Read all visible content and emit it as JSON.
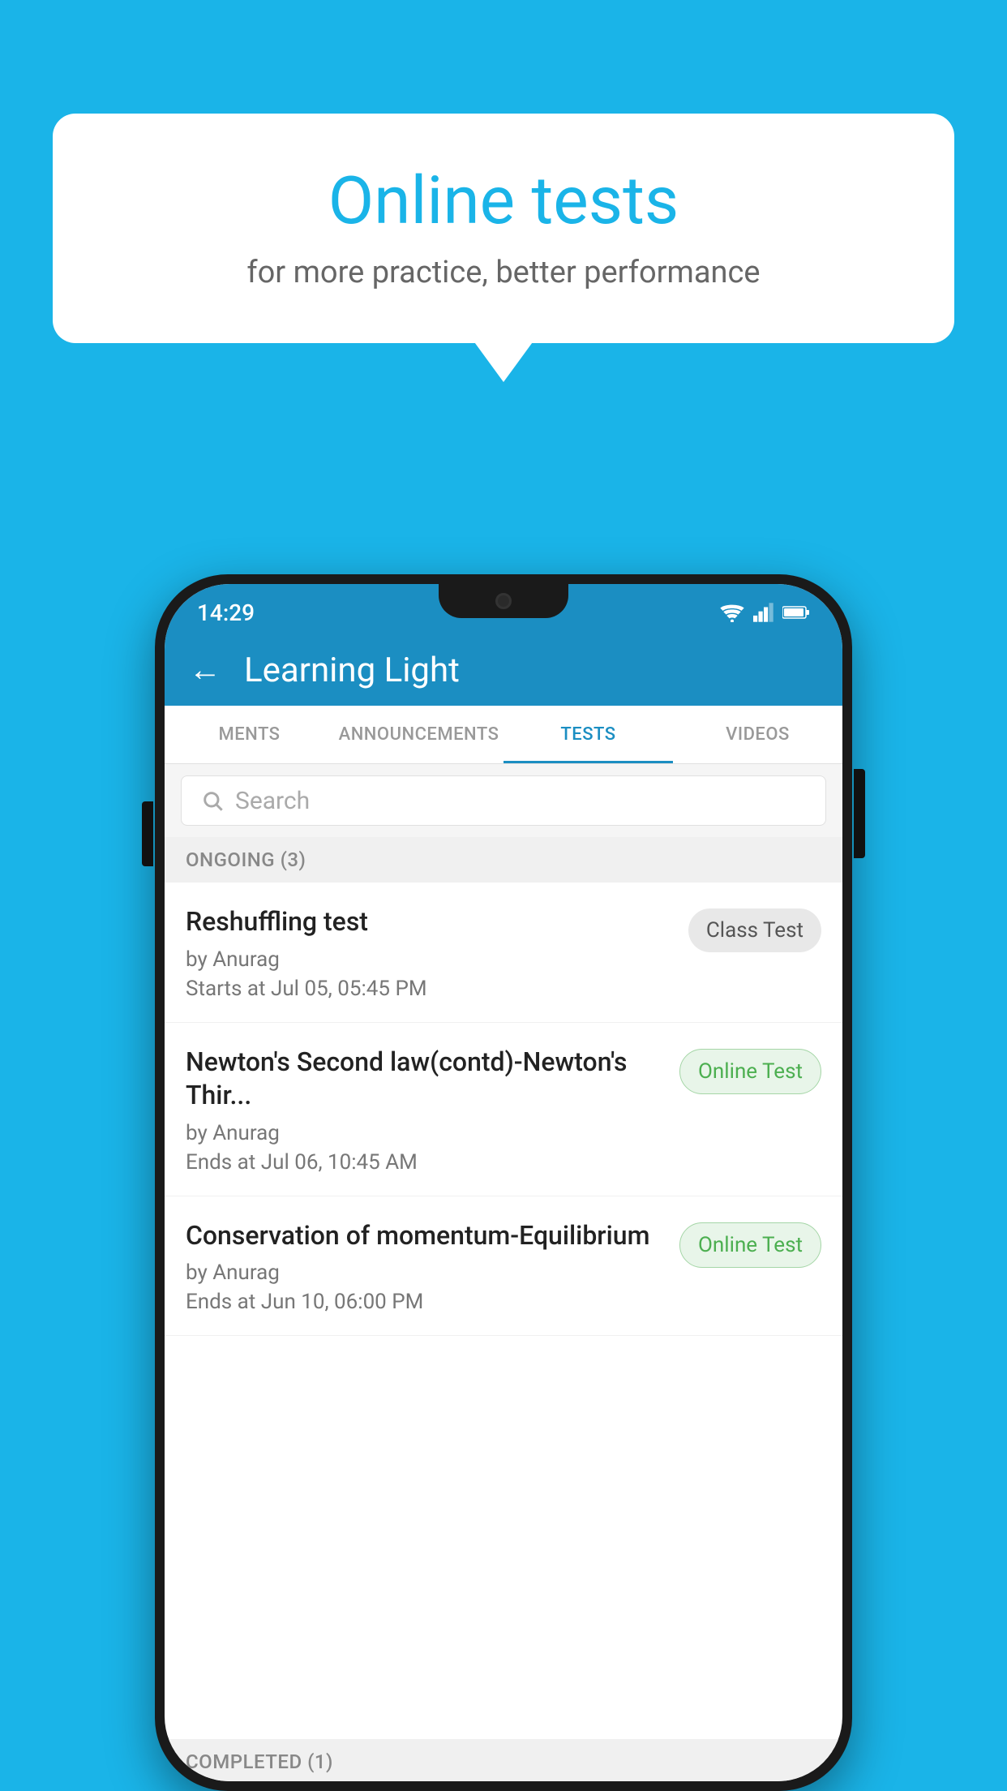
{
  "background": {
    "color": "#1ab4e8"
  },
  "speech_bubble": {
    "title": "Online tests",
    "subtitle": "for more practice, better performance"
  },
  "phone": {
    "status_bar": {
      "time": "14:29",
      "icons": [
        "wifi",
        "signal",
        "battery"
      ]
    },
    "header": {
      "title": "Learning Light",
      "back_label": "←"
    },
    "tabs": [
      {
        "label": "MENTS",
        "active": false
      },
      {
        "label": "ANNOUNCEMENTS",
        "active": false
      },
      {
        "label": "TESTS",
        "active": true
      },
      {
        "label": "VIDEOS",
        "active": false
      }
    ],
    "search": {
      "placeholder": "Search"
    },
    "sections": [
      {
        "title": "ONGOING (3)",
        "tests": [
          {
            "name": "Reshuffling test",
            "by": "by Anurag",
            "time": "Starts at  Jul 05, 05:45 PM",
            "badge": "Class Test",
            "badge_type": "class"
          },
          {
            "name": "Newton's Second law(contd)-Newton's Thir...",
            "by": "by Anurag",
            "time": "Ends at  Jul 06, 10:45 AM",
            "badge": "Online Test",
            "badge_type": "online"
          },
          {
            "name": "Conservation of momentum-Equilibrium",
            "by": "by Anurag",
            "time": "Ends at  Jun 10, 06:00 PM",
            "badge": "Online Test",
            "badge_type": "online"
          }
        ]
      },
      {
        "title": "COMPLETED (1)",
        "tests": []
      }
    ]
  }
}
